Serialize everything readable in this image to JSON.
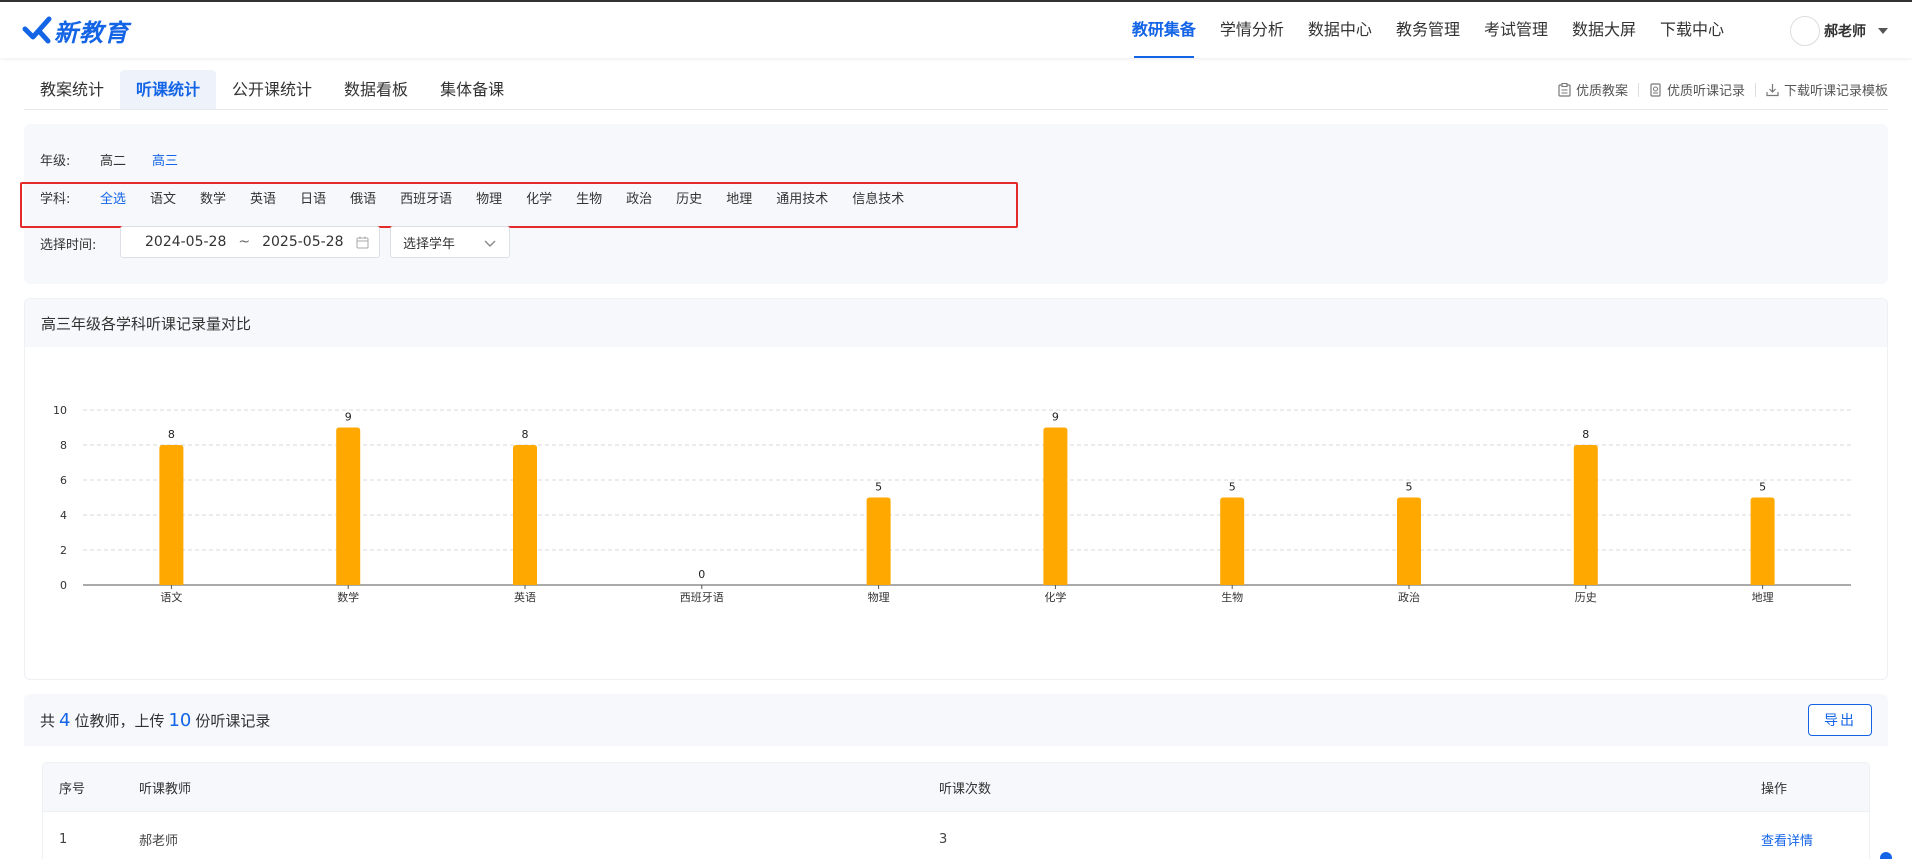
{
  "header": {
    "logo_text": "新教育",
    "nav": [
      "教研集备",
      "学情分析",
      "数据中心",
      "教务管理",
      "考试管理",
      "数据大屏",
      "下载中心"
    ],
    "active_nav": 0,
    "user_name": "郝老师"
  },
  "tabs": {
    "items": [
      "教案统计",
      "听课统计",
      "公开课统计",
      "数据看板",
      "集体备课"
    ],
    "active": 1
  },
  "quick_links": [
    "优质教案",
    "优质听课记录",
    "下载听课记录模板"
  ],
  "filters": {
    "grade_label": "年级:",
    "grades": [
      "高二",
      "高三"
    ],
    "active_grade": 1,
    "subject_label": "学科:",
    "subjects": [
      "全选",
      "语文",
      "数学",
      "英语",
      "日语",
      "俄语",
      "西班牙语",
      "物理",
      "化学",
      "生物",
      "政治",
      "历史",
      "地理",
      "通用技术",
      "信息技术"
    ],
    "active_subject": 0,
    "time_label": "选择时间:",
    "date_start": "2024-05-28",
    "date_sep": "~",
    "date_end": "2025-05-28",
    "year_select": "选择学年"
  },
  "chart_data": {
    "type": "bar",
    "title": "高三年级各学科听课记录量对比",
    "categories": [
      "语文",
      "数学",
      "英语",
      "西班牙语",
      "物理",
      "化学",
      "生物",
      "政治",
      "历史",
      "地理"
    ],
    "values": [
      8,
      9,
      8,
      0,
      5,
      9,
      5,
      5,
      8,
      5
    ],
    "ylim": [
      0,
      10
    ],
    "yticks": [
      0,
      2,
      4,
      6,
      8,
      10
    ],
    "grid": true,
    "bar_color": "#ffa800"
  },
  "summary": {
    "prefix": "共",
    "teacher_count": "4",
    "mid": "位教师，上传",
    "record_count": "10",
    "suffix": "份听课记录",
    "export_label": "导出"
  },
  "table": {
    "columns": [
      "序号",
      "听课教师",
      "听课次数",
      "操作"
    ],
    "rows": [
      {
        "index": "1",
        "teacher": "郝老师",
        "count": "3",
        "action": "查看详情"
      }
    ]
  },
  "colors": {
    "primary": "#1464e6",
    "highlight": "#e32b2b"
  }
}
